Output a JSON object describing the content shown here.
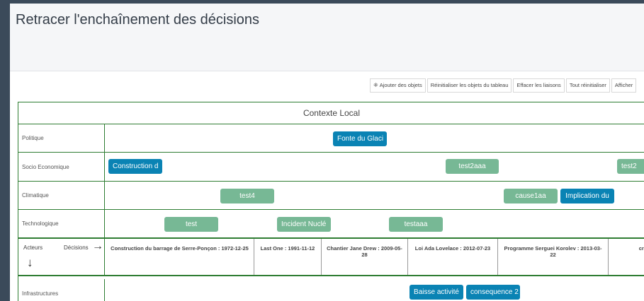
{
  "page": {
    "title": "Retracer l'enchaînement des décisions"
  },
  "toolbar": {
    "add_objects": "Ajouter des objets",
    "add_objects_icon": "move-arrows-icon",
    "reset_table_objects": "Réinitialiser les objets du tableau",
    "clear_links": "Effacer les liaisons",
    "reset_all": "Tout réinitialiser",
    "show": "Afficher"
  },
  "board": {
    "context_title": "Contexte Local",
    "rows": [
      {
        "label": "Politique",
        "chips": [
          {
            "text": "Fonte du Glaci",
            "color": "blue"
          }
        ]
      },
      {
        "label": "Socio Economique",
        "chips": [
          {
            "text": "Construction d",
            "color": "blue"
          },
          {
            "text": "test2aaa",
            "color": "green"
          },
          {
            "text": "test2",
            "color": "green"
          }
        ]
      },
      {
        "label": "Climatique",
        "chips": [
          {
            "text": "test4",
            "color": "green"
          },
          {
            "text": "cause1aa",
            "color": "green"
          },
          {
            "text": "Implication du",
            "color": "blue"
          }
        ]
      },
      {
        "label": "Technologique",
        "chips": [
          {
            "text": "test",
            "color": "green"
          },
          {
            "text": "Incident Nuclé",
            "color": "green"
          },
          {
            "text": "testaaa",
            "color": "green"
          }
        ]
      }
    ],
    "decisions_header": {
      "actors": "Acteurs",
      "decisions": "Décisions",
      "arrow_right": "→",
      "arrow_down": "↓"
    },
    "decisions": [
      "Construction du barrage de Serre-Ponçon : 1972-12-25",
      "Last One : 1991-11-12",
      "Chantier Jane Drew : 2009-05-28",
      "Loi Ada Lovelace : 2012-07-23",
      "Programme Serguei Korolev : 2013-03-22",
      "cré"
    ],
    "actor_rows": [
      {
        "label": "Infrastructures",
        "chips": [
          {
            "text": "Baisse activité",
            "color": "blue"
          },
          {
            "text": "consequence 2",
            "color": "blue"
          }
        ]
      }
    ],
    "colors": {
      "border": "#2e7d32",
      "blue_chip": "#0a83b4",
      "green_chip": "#77b895"
    }
  }
}
